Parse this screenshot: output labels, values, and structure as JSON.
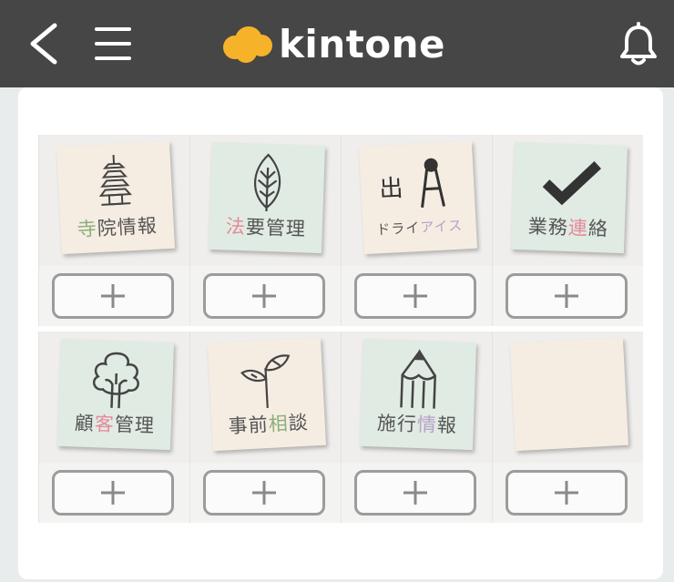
{
  "header": {
    "logo_text": "kintone",
    "icons": {
      "back": "back-chevron-icon",
      "menu": "hamburger-menu-icon",
      "notifications": "bell-icon"
    }
  },
  "apps": [
    {
      "name": "寺院情報",
      "parts": [
        "寺",
        "院情報"
      ],
      "accent_color": "#8bb07a",
      "icon": "pagoda-icon",
      "style": "cream",
      "add_label": "+"
    },
    {
      "name": "法要管理",
      "parts": [
        "法",
        "要管理"
      ],
      "accent_color": "#e58a9a",
      "icon": "leaf-icon",
      "style": "mint",
      "add_label": "+"
    },
    {
      "name": "出ドライアイス",
      "parts": [
        "ドライ",
        "アイス"
      ],
      "accent_color": "#b9a0c8",
      "icon": "penguin-icon",
      "style": "cream",
      "add_label": "+"
    },
    {
      "name": "業務連絡",
      "parts": [
        "業務",
        "連",
        "絡"
      ],
      "accent_color": "#e58a9a",
      "icon": "checkmark-icon",
      "style": "mint",
      "add_label": "+"
    },
    {
      "name": "顧客管理",
      "parts": [
        "顧",
        "客",
        "管理"
      ],
      "accent_color": "#e58a9a",
      "icon": "tree-icon",
      "style": "mint",
      "add_label": "+"
    },
    {
      "name": "事前相談",
      "parts": [
        "事前",
        "相",
        "談"
      ],
      "accent_color": "#8bb07a",
      "icon": "sprout-icon",
      "style": "cream",
      "add_label": "+"
    },
    {
      "name": "施行情報",
      "parts": [
        "施行",
        "情",
        "報"
      ],
      "accent_color": "#b9a0c8",
      "icon": "pencil-icon",
      "style": "mint",
      "add_label": "+"
    },
    {
      "name": "",
      "parts": [],
      "accent_color": "#f6ede2",
      "icon": "blank-note",
      "style": "cream",
      "add_label": "+"
    }
  ]
}
